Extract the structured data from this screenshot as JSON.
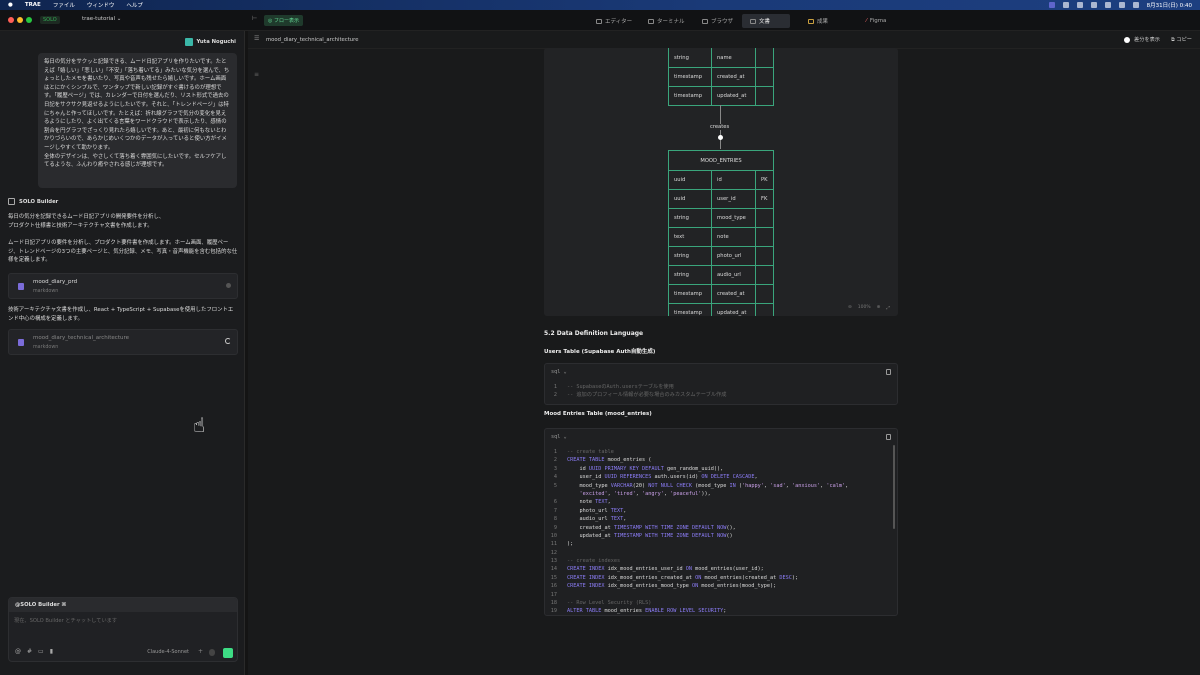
{
  "menubar": {
    "app": "TRAE",
    "items": [
      "ファイル",
      "ウィンドウ",
      "ヘルプ"
    ],
    "clock": "8月31日(日) 0:40"
  },
  "topbar": {
    "mode": "SOLO",
    "project": "trae-tutorial",
    "flow_label": "フロー表示",
    "tabs": [
      {
        "label": "エディター"
      },
      {
        "label": "ターミナル"
      },
      {
        "label": "ブラウザ"
      },
      {
        "label": "文書",
        "active": true
      },
      {
        "label": "成果"
      },
      {
        "label": "Figma"
      }
    ]
  },
  "chat": {
    "user_name": "Yuta Noguchi",
    "user_message": "毎日の気分をサクッと記録できる、ムード日記アプリを作りたいです。たとえば「嬉しい」「悲しい」「不安」「落ち着いてる」みたいな気分を選んで、ちょっとしたメモを書いたり、写真や音声も残せたら嬉しいです。ホーム画面はとにかくシンプルで、ワンタップで新しい記録がすぐ書けるのが理想です。「履歴ページ」では、カレンダーで日付を選んだり、リスト形式で過去の日記をサクサク見返せるようにしたいです。それと、「トレンドページ」は特にちゃんと作ってほしいです。たとえば：折れ線グラフで気分の変化を見えるようにしたり、よく出てくる言葉をワードクラウドで表示したり、感情の割合を円グラフでざっくり見れたら嬉しいです。あと、最初に何もないとわかりづらいので、あらかじめいくつかのデータが入っていると使い方がイメージしやすくて助かります。\n全体のデザインは、やさしくて落ち着く雰囲気にしたいです。セルフケアしてるような、ふんわり癒やされる感じが理想です。",
    "assistant_name": "SOLO Builder",
    "msg1": "毎日の気分を記録できるムード日記アプリの開発要件を分析し、\nプロダクト仕様書と技術アーキテクチャ文書を作成します。",
    "msg2": "ムード日記アプリの要件を分析し、プロダクト要件書を作成します。ホーム画面、履歴ページ、トレンドページの3つの主要ページと、気分記録、メモ、写真・音声機能を含む包括的な仕様を定義します。",
    "file1": {
      "name": "mood_diary_prd",
      "type": "markdown"
    },
    "msg3": "技術アーキテクチャ文書を作成し、React + TypeScript + Supabaseを使用したフロントエンド中心の構成を定義します。",
    "file2": {
      "name": "mood_diary_technical_architecture",
      "type": "markdown"
    },
    "input_mention": "@SOLO Builder ⌘",
    "input_placeholder": "現在、SOLO Builder とチャットしています",
    "model": "Claude-4-Sonnet"
  },
  "doc": {
    "filename": "mood_diary_technical_architecture",
    "show_diff": "差分を表示",
    "copy": "コピー",
    "users_rows": [
      [
        "string",
        "name",
        ""
      ],
      [
        "timestamp",
        "created_at",
        ""
      ],
      [
        "timestamp",
        "updated_at",
        ""
      ]
    ],
    "relation": "creates",
    "entries_title": "MOOD_ENTRIES",
    "entries_rows": [
      [
        "uuid",
        "id",
        "PK"
      ],
      [
        "uuid",
        "user_id",
        "FK"
      ],
      [
        "string",
        "mood_type",
        ""
      ],
      [
        "text",
        "note",
        ""
      ],
      [
        "string",
        "photo_url",
        ""
      ],
      [
        "string",
        "audio_url",
        ""
      ],
      [
        "timestamp",
        "created_at",
        ""
      ],
      [
        "timestamp",
        "updated_at",
        ""
      ]
    ],
    "zoom": "100%",
    "h_ddl": "5.2 Data Definition Language",
    "h_users": "Users Table (Supabase Auth自動生成)",
    "h_entries": "Mood Entries Table (mood_entries)",
    "lang": "sql",
    "code1": [
      [
        "1",
        "-- SupabaseのAuth.usersテーブルを使用"
      ],
      [
        "2",
        "-- 追加のプロフィール情報が必要な場合のみカスタムテーブル作成"
      ]
    ],
    "code2": [
      [
        "1",
        "-- create table"
      ],
      [
        "2",
        "CREATE TABLE mood_entries ("
      ],
      [
        "3",
        "    id UUID PRIMARY KEY DEFAULT gen_random_uuid(),"
      ],
      [
        "4",
        "    user_id UUID REFERENCES auth.users(id) ON DELETE CASCADE,"
      ],
      [
        "5",
        "    mood_type VARCHAR(20) NOT NULL CHECK (mood_type IN ('happy', 'sad', 'anxious', 'calm',"
      ],
      [
        "",
        "    'excited', 'tired', 'angry', 'peaceful')),"
      ],
      [
        "6",
        "    note TEXT,"
      ],
      [
        "7",
        "    photo_url TEXT,"
      ],
      [
        "8",
        "    audio_url TEXT,"
      ],
      [
        "9",
        "    created_at TIMESTAMP WITH TIME ZONE DEFAULT NOW(),"
      ],
      [
        "10",
        "    updated_at TIMESTAMP WITH TIME ZONE DEFAULT NOW()"
      ],
      [
        "11",
        ");"
      ],
      [
        "12",
        ""
      ],
      [
        "13",
        "-- create indexes"
      ],
      [
        "14",
        "CREATE INDEX idx_mood_entries_user_id ON mood_entries(user_id);"
      ],
      [
        "15",
        "CREATE INDEX idx_mood_entries_created_at ON mood_entries(created_at DESC);"
      ],
      [
        "16",
        "CREATE INDEX idx_mood_entries_mood_type ON mood_entries(mood_type);"
      ],
      [
        "17",
        ""
      ],
      [
        "18",
        "-- Row Level Security (RLS)"
      ],
      [
        "19",
        "ALTER TABLE mood_entries ENABLE ROW LEVEL SECURITY;"
      ]
    ]
  },
  "colors": {
    "accent": "#3ddc84",
    "er_border": "#3aa57c",
    "keyword": "#8b7cf6"
  }
}
